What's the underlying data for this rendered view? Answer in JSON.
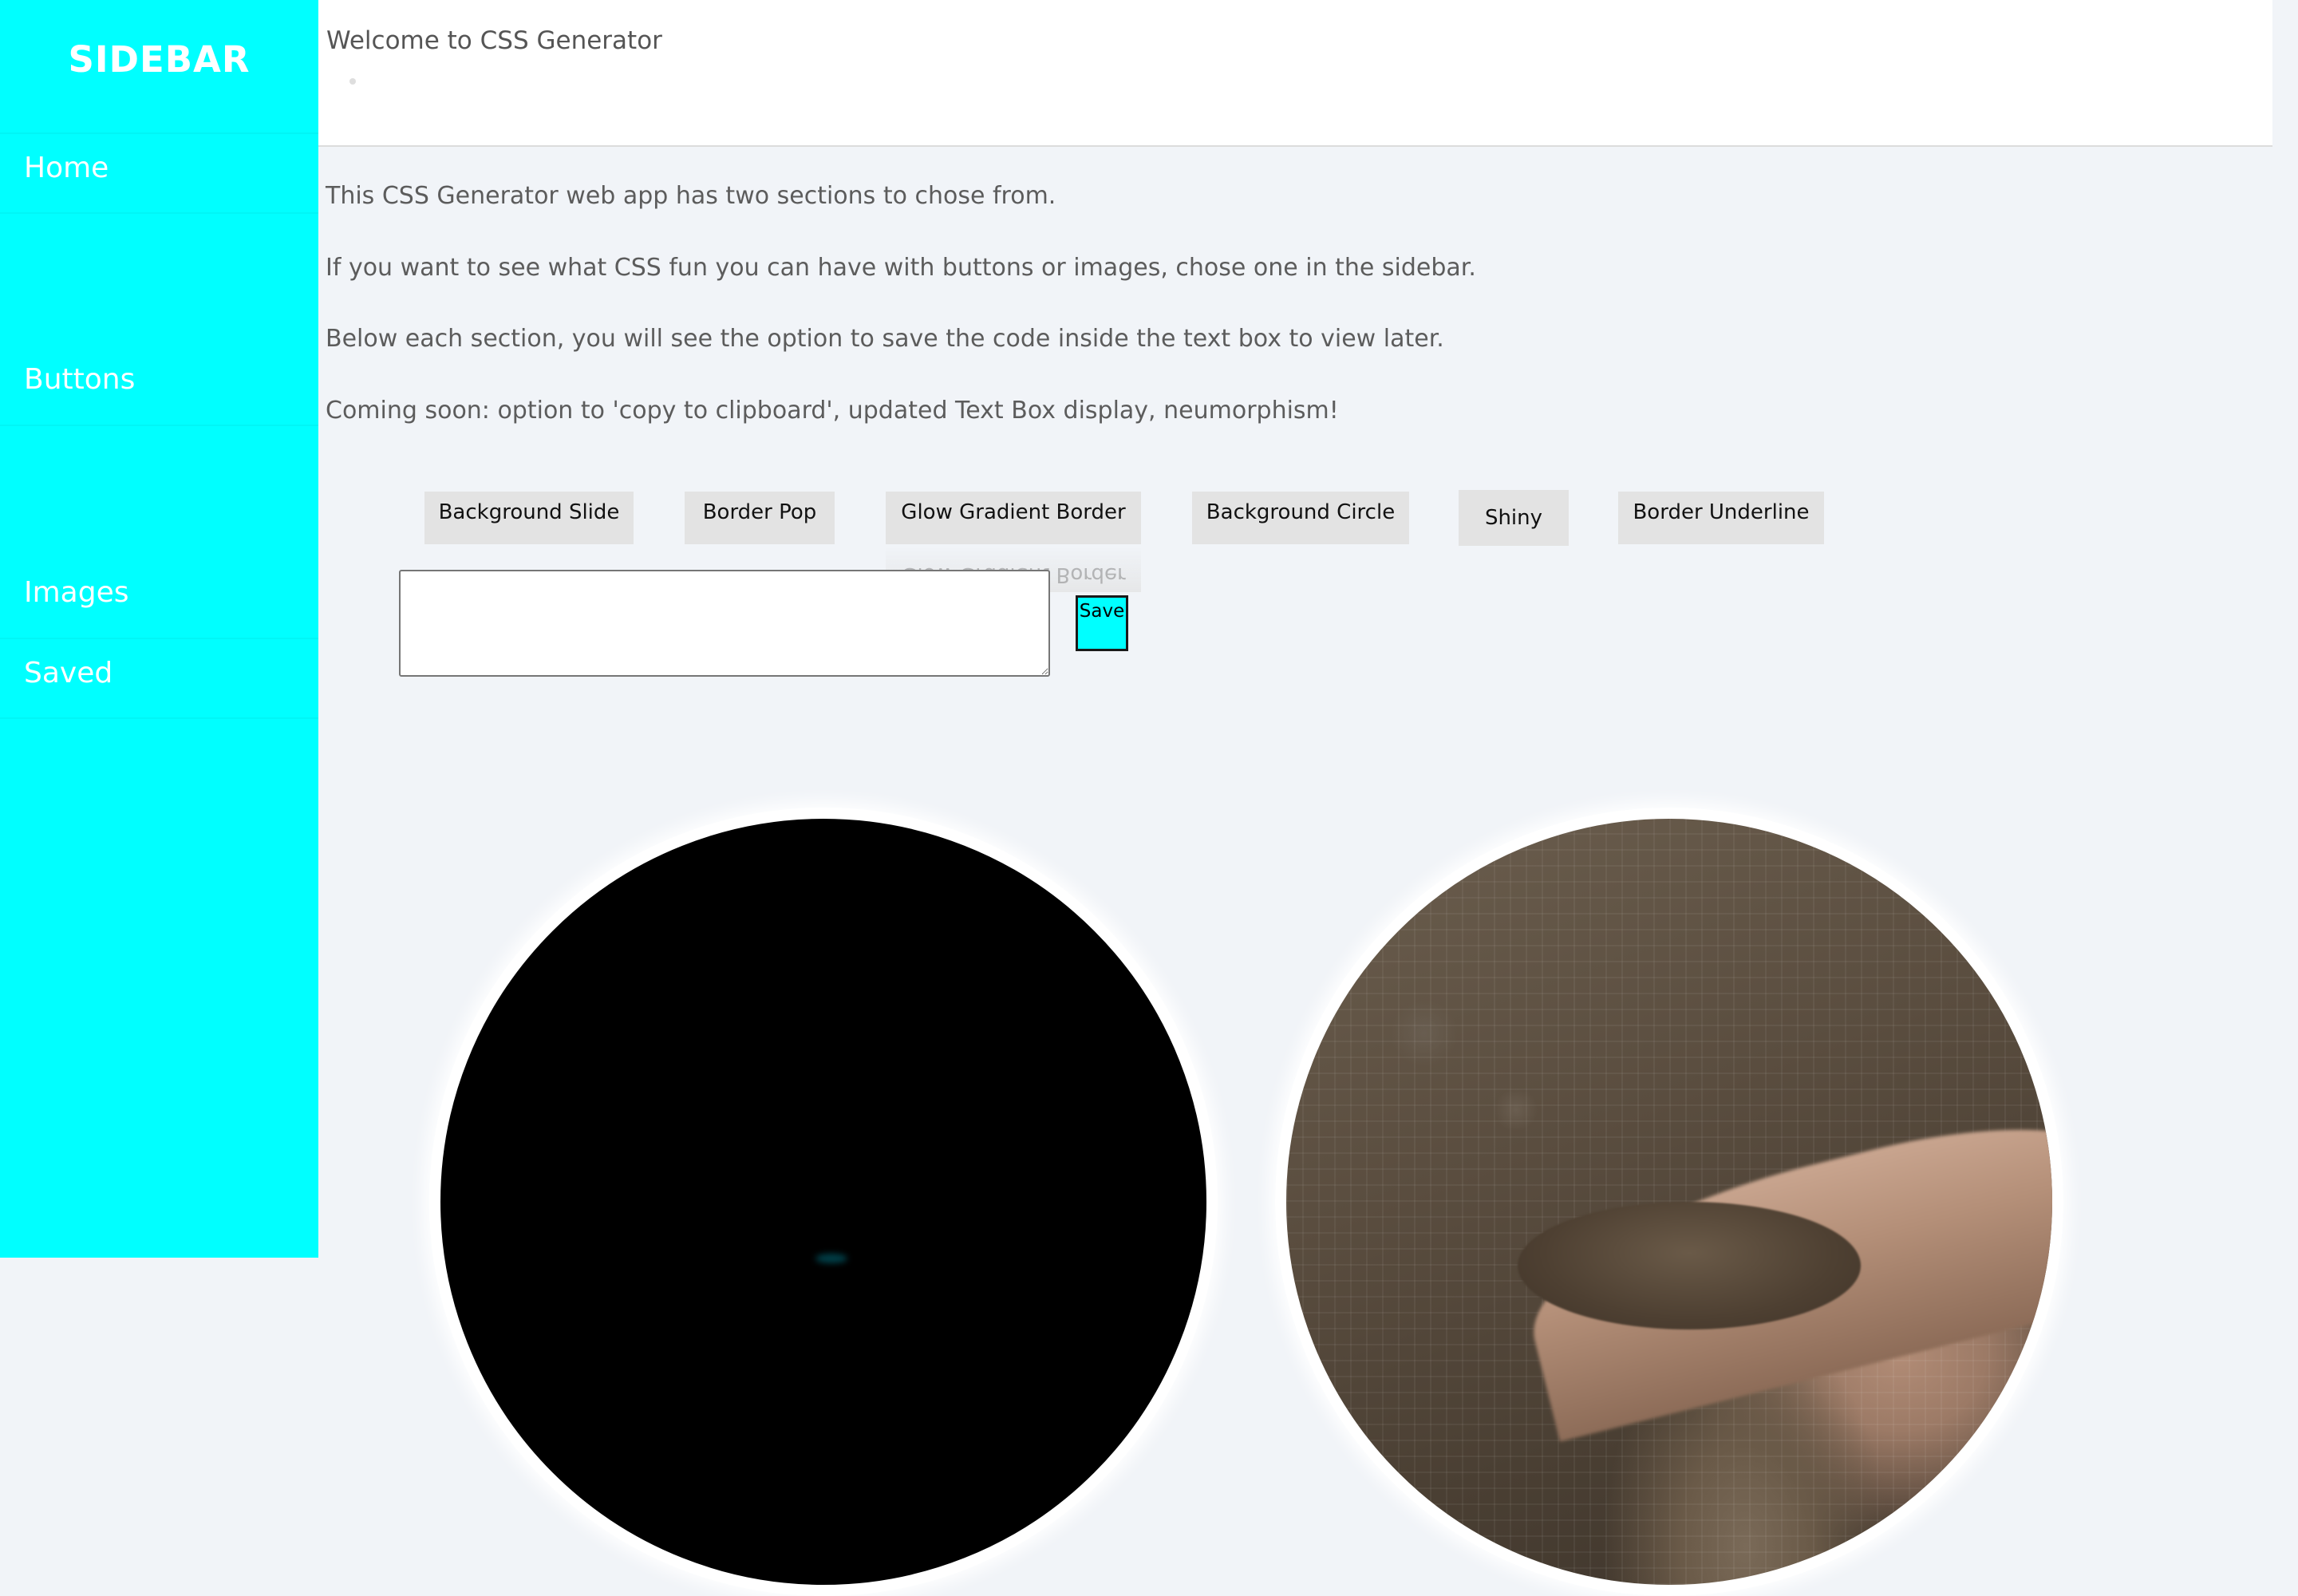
{
  "sidebar": {
    "title": "SIDEBAR",
    "items": [
      {
        "label": "Home"
      },
      {
        "label": "Buttons"
      },
      {
        "label": "Images"
      },
      {
        "label": "Saved"
      }
    ]
  },
  "header": {
    "title": "Welcome to CSS Generator"
  },
  "main": {
    "paragraphs": [
      "This CSS Generator web app has two sections to chose from.",
      "If you want to see what CSS fun you can have with buttons or images, chose one in the sidebar.",
      "Below each section, you will see the option to save the code inside the text box to view later.",
      "Coming soon: option to 'copy to clipboard', updated Text Box display, neumorphism!"
    ],
    "buttons": [
      {
        "label": "Background Slide"
      },
      {
        "label": "Border Pop"
      },
      {
        "label": "Glow Gradient Border"
      },
      {
        "label": "Background Circle"
      },
      {
        "label": "Shiny"
      },
      {
        "label": "Border Underline"
      }
    ],
    "code_box": {
      "value": "",
      "placeholder": ""
    },
    "save_label": "Save"
  },
  "colors": {
    "sidebar_bg": "#00ffff",
    "page_bg": "#f1f4f8",
    "button_bg": "#e3e3e3"
  }
}
